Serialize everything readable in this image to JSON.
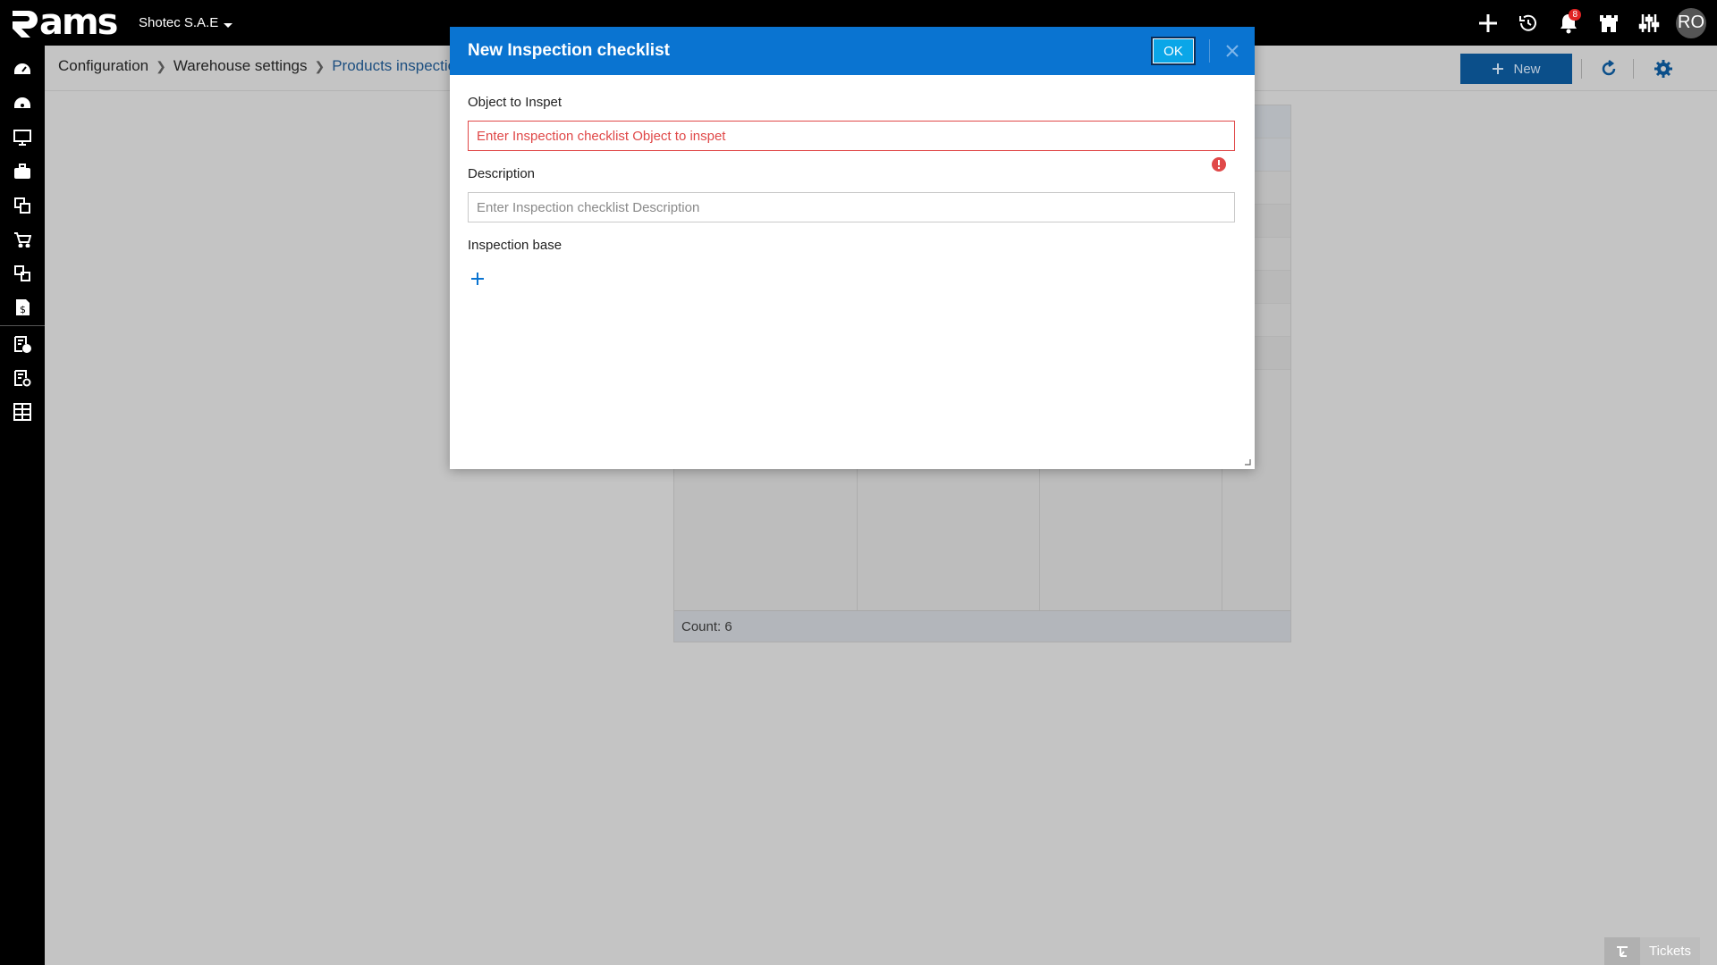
{
  "app": {
    "logo_text": "ams",
    "company": "Shotec S.A.E"
  },
  "topbar": {
    "notifications_count": "8",
    "user_initials": "RO"
  },
  "breadcrumb": {
    "items": [
      "Configuration",
      "Warehouse settings"
    ],
    "current": "Products inspectio"
  },
  "toolbar": {
    "new_label": "New"
  },
  "grid": {
    "count_label": "Count: 6"
  },
  "modal": {
    "title": "New Inspection checklist",
    "ok_label": "OK",
    "fields": {
      "object": {
        "label": "Object to Inspet",
        "value": "",
        "placeholder": "Enter Inspection checklist Object to inspet"
      },
      "description": {
        "label": "Description",
        "value": "",
        "placeholder": "Enter Inspection checklist Description"
      },
      "base": {
        "label": "Inspection base"
      }
    }
  },
  "footer": {
    "tickets_label": "Tickets"
  },
  "colors": {
    "accent": "#0a74d1",
    "header_bg": "#000000",
    "error": "#e04848",
    "new_button": "#0b4f8a"
  }
}
